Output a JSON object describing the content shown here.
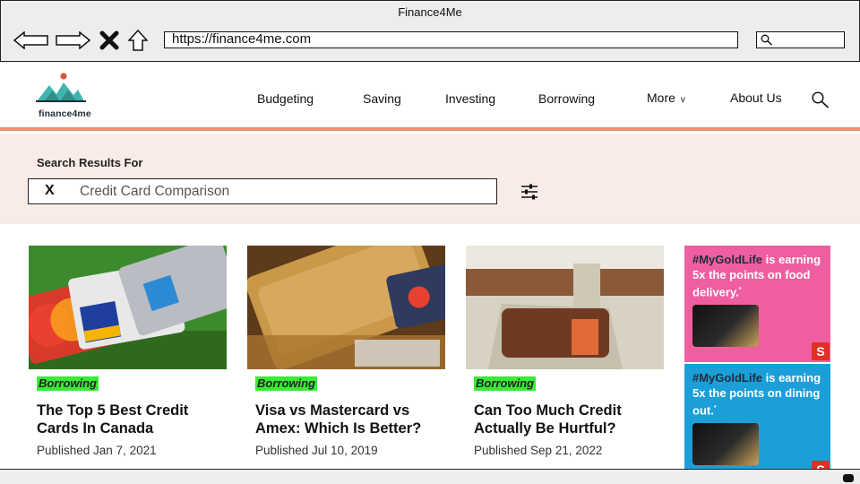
{
  "browser": {
    "window_title": "Finance4Me",
    "url": "https://finance4me.com",
    "controls": [
      "back-arrow-icon",
      "forward-arrow-icon",
      "close-icon",
      "home-icon"
    ]
  },
  "site": {
    "logo_text": "finance4me",
    "nav": [
      {
        "label": "Budgeting"
      },
      {
        "label": "Saving"
      },
      {
        "label": "Investing"
      },
      {
        "label": "Borrowing"
      },
      {
        "label": "More",
        "chevron": "v"
      },
      {
        "label": "About Us"
      }
    ]
  },
  "search": {
    "results_label": "Search Results For",
    "clear_label": "X",
    "query": "Credit Card Comparison"
  },
  "articles": [
    {
      "category": "Borrowing",
      "title": "The Top 5 Best Credit Cards In Canada",
      "date": "Published Jan 7, 2021"
    },
    {
      "category": "Borrowing",
      "title": "Visa vs Mastercard vs Amex: Which Is Better?",
      "date": "Published Jul 10, 2019"
    },
    {
      "category": "Borrowing",
      "title": "Can Too Much Credit Actually Be Hurtful?",
      "date": "Published Sep 21, 2022"
    }
  ],
  "ads": [
    {
      "hashtag": "#MyGoldLife",
      "line1": " is earning 5x the points on food delivery.",
      "mark": "*",
      "bg": "#ef5fa0"
    },
    {
      "hashtag": "#MyGoldLife",
      "line1": " is earning 5x the points on dining out.",
      "mark": "*",
      "bg": "#1c9fd9"
    }
  ],
  "colors": {
    "accent_border": "#e98f71",
    "search_band": "#f9ebe5",
    "tag_green": "#3bea37"
  }
}
